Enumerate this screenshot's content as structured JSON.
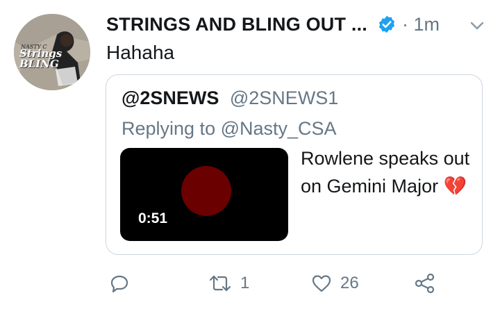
{
  "tweet": {
    "display_name": "STRINGS AND BLING OUT ...",
    "time": "· 1m",
    "text": "Hahaha",
    "avatar_text": "Strings BLING",
    "avatar_small_text": "NASTY C"
  },
  "quoted": {
    "name": "@2SNEWS",
    "handle": "@2SNEWS1",
    "replying_to": "Replying to @Nasty_CSA",
    "video_duration": "0:51",
    "text": "Rowlene speaks out on Gemini Major 💔"
  },
  "actions": {
    "retweets": "1",
    "likes": "26"
  },
  "colors": {
    "verified": "#1da1f2",
    "secondary_text": "#657786",
    "border": "#ccd6dd"
  }
}
